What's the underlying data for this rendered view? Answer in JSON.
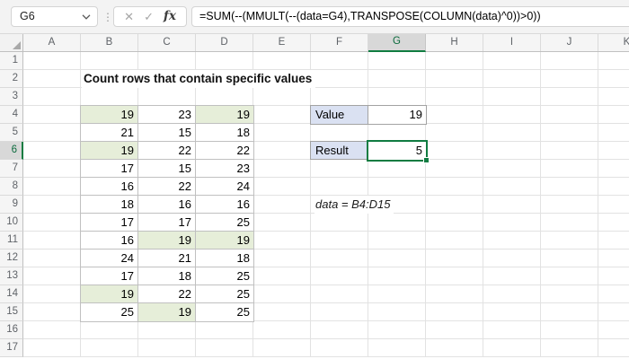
{
  "formula_bar": {
    "name_box": "G6",
    "formula": "=SUM(--(MMULT(--(data=G4),TRANSPOSE(COLUMN(data)^0))>0))",
    "cancel_icon": "✕",
    "enter_icon": "✓",
    "fx_icon": "fx"
  },
  "sheet": {
    "column_headers": [
      "A",
      "B",
      "C",
      "D",
      "E",
      "F",
      "G",
      "H",
      "I",
      "J",
      "K"
    ],
    "row_headers": [
      "1",
      "2",
      "3",
      "4",
      "5",
      "6",
      "7",
      "8",
      "9",
      "10",
      "11",
      "12",
      "13",
      "14",
      "15",
      "16",
      "17"
    ],
    "selected_column": "G",
    "selected_row": "6",
    "selected_cell": "G6",
    "title": "Count rows that contain specific values",
    "table": {
      "range": "B4:D15",
      "rows": [
        [
          {
            "v": "19",
            "hl": true
          },
          {
            "v": "23",
            "hl": false
          },
          {
            "v": "19",
            "hl": true
          }
        ],
        [
          {
            "v": "21",
            "hl": false
          },
          {
            "v": "15",
            "hl": false
          },
          {
            "v": "18",
            "hl": false
          }
        ],
        [
          {
            "v": "19",
            "hl": true
          },
          {
            "v": "22",
            "hl": false
          },
          {
            "v": "22",
            "hl": false
          }
        ],
        [
          {
            "v": "17",
            "hl": false
          },
          {
            "v": "15",
            "hl": false
          },
          {
            "v": "23",
            "hl": false
          }
        ],
        [
          {
            "v": "16",
            "hl": false
          },
          {
            "v": "22",
            "hl": false
          },
          {
            "v": "24",
            "hl": false
          }
        ],
        [
          {
            "v": "18",
            "hl": false
          },
          {
            "v": "16",
            "hl": false
          },
          {
            "v": "16",
            "hl": false
          }
        ],
        [
          {
            "v": "17",
            "hl": false
          },
          {
            "v": "17",
            "hl": false
          },
          {
            "v": "25",
            "hl": false
          }
        ],
        [
          {
            "v": "16",
            "hl": false
          },
          {
            "v": "19",
            "hl": true
          },
          {
            "v": "19",
            "hl": true
          }
        ],
        [
          {
            "v": "24",
            "hl": false
          },
          {
            "v": "21",
            "hl": false
          },
          {
            "v": "18",
            "hl": false
          }
        ],
        [
          {
            "v": "17",
            "hl": false
          },
          {
            "v": "18",
            "hl": false
          },
          {
            "v": "25",
            "hl": false
          }
        ],
        [
          {
            "v": "19",
            "hl": true
          },
          {
            "v": "22",
            "hl": false
          },
          {
            "v": "25",
            "hl": false
          }
        ],
        [
          {
            "v": "25",
            "hl": false
          },
          {
            "v": "19",
            "hl": true
          },
          {
            "v": "25",
            "hl": false
          }
        ]
      ]
    },
    "value_label": "Value",
    "value": "19",
    "result_label": "Result",
    "result": "5",
    "annotation": "data = B4:D15"
  },
  "colors": {
    "excel_green": "#107c41",
    "highlight_green_fill": "#e6eed9",
    "label_blue_fill": "#dae1f2",
    "selected_header_bg": "#d8d8d8",
    "gridline": "#e2e2e2"
  }
}
